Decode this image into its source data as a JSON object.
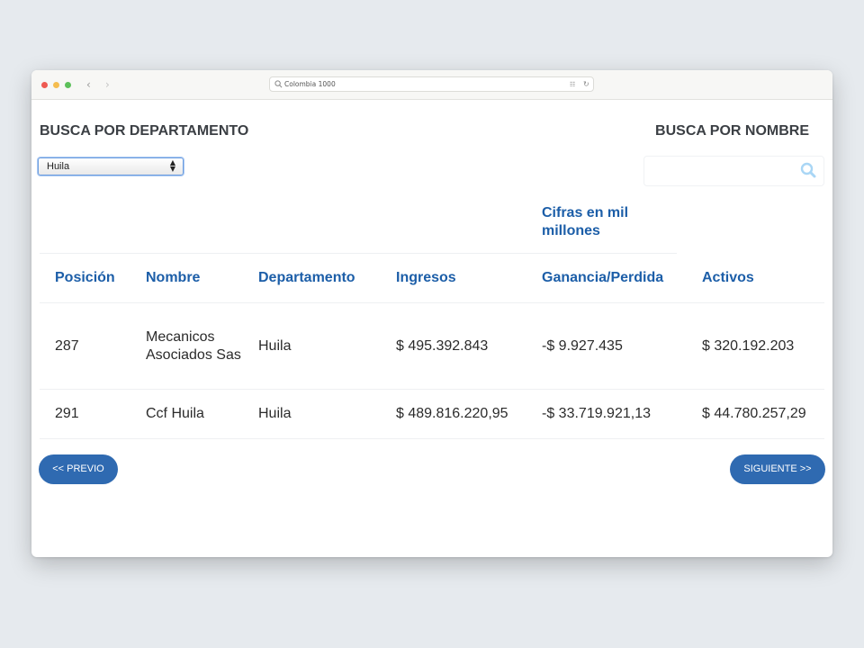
{
  "browser": {
    "url": "Colombia 1000",
    "translate_icon": "translate-icon",
    "reload_icon": "reload-icon"
  },
  "filters": {
    "department_heading": "BUSCA POR DEPARTAMENTO",
    "department_selected": "Huila",
    "name_heading": "BUSCA POR NOMBRE",
    "name_value": ""
  },
  "table": {
    "note": "Cifras en mil millones",
    "columns": [
      "Posición",
      "Nombre",
      "Departamento",
      "Ingresos",
      "Ganancia/Perdida",
      "Activos"
    ],
    "rows": [
      [
        "287",
        "Mecanicos Asociados Sas",
        "Huila",
        "$ 495.392.843",
        "-$ 9.927.435",
        "$ 320.192.203"
      ],
      [
        "291",
        "Ccf Huila",
        "Huila",
        "$ 489.816.220,95",
        "-$ 33.719.921,13",
        "$ 44.780.257,29"
      ]
    ]
  },
  "pagination": {
    "prev_label": "<< PREVIO",
    "next_label": "SIGUIENTE >>"
  },
  "colors": {
    "accent": "#1c5ea8",
    "button": "#2f6ab1",
    "background": "#e6eaee"
  }
}
